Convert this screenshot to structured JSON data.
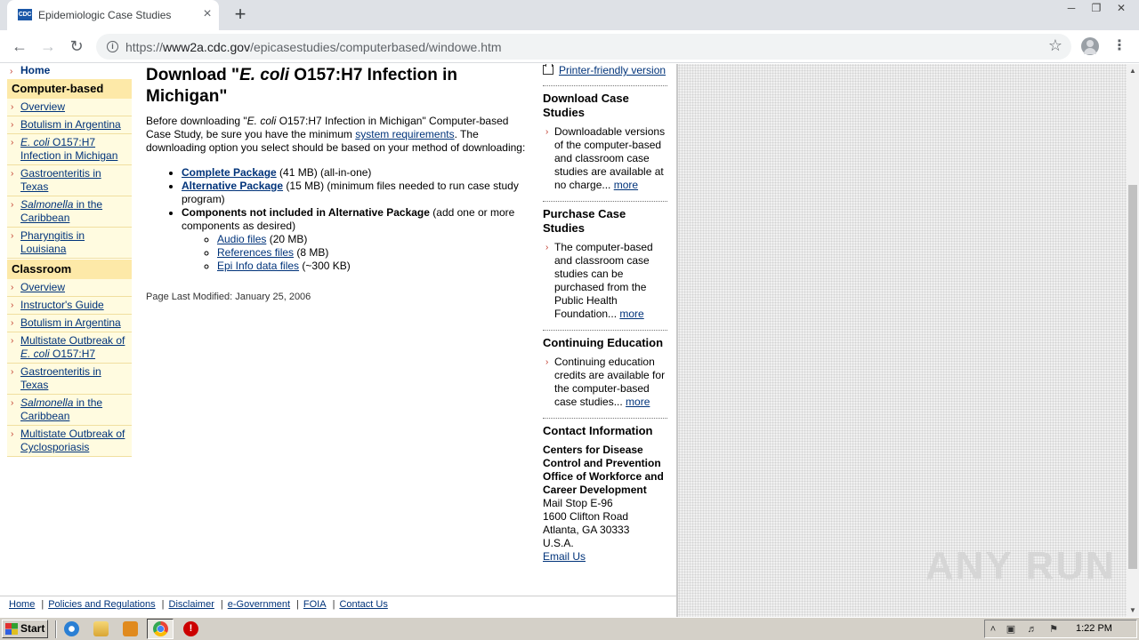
{
  "browser": {
    "tab_title": "Epidemiologic Case Studies",
    "favicon_text": "CDC",
    "url_prefix": "https://",
    "url_host": "www2a.cdc.gov",
    "url_path": "/epicasestudies/computerbased/windowe.htm"
  },
  "leftnav": {
    "home": "Home",
    "computer_based": {
      "heading": "Computer-based",
      "items": [
        {
          "label": "Overview"
        },
        {
          "label": "Botulism in Argentina"
        },
        {
          "italic": "E. coli",
          "rest": " O157:H7 Infection in Michigan"
        },
        {
          "label": "Gastroenteritis in Texas"
        },
        {
          "italic": "Salmonella",
          "rest": " in the Caribbean"
        },
        {
          "label": "Pharyngitis in Louisiana"
        }
      ]
    },
    "classroom": {
      "heading": "Classroom",
      "items": [
        {
          "label": "Overview"
        },
        {
          "label": "Instructor's Guide"
        },
        {
          "label": "Botulism in Argentina"
        },
        {
          "pre": "Multistate Outbreak of ",
          "italic": "E. coli",
          "rest": " O157:H7"
        },
        {
          "label": "Gastroenteritis in Texas"
        },
        {
          "italic": "Salmonella",
          "rest": " in the Caribbean"
        },
        {
          "label": "Multistate Outbreak of Cyclosporiasis"
        }
      ]
    }
  },
  "main": {
    "title_pre": "Download \"",
    "title_italic": "E. coli",
    "title_rest": " O157:H7 Infection in Michigan\"",
    "intro_1": "Before downloading \"",
    "intro_italic": "E. coli",
    "intro_2": " O157:H7 Infection in Michigan\" Computer-based Case Study, be sure you have the minimum ",
    "intro_link": "system requirements",
    "intro_3": ". The downloading option you select should be based on your method of downloading:",
    "complete_label": "Complete Package",
    "complete_desc": " (41 MB) (all-in-one)",
    "alternative_label": "Alternative Package",
    "alternative_desc": " (15 MB) (minimum files needed to run case study program)",
    "components_label": "Components not included in Alternative Package",
    "components_desc": " (add one or more components as desired)",
    "audio_label": "Audio files",
    "audio_desc": " (20 MB)",
    "references_label": "References files",
    "references_desc": " (8 MB)",
    "epiinfo_label": "Epi Info data files",
    "epiinfo_desc": " (~300 KB)",
    "modified": "Page Last Modified: January 25, 2006"
  },
  "rightcol": {
    "printer": "Printer-friendly version",
    "download_head": "Download Case Studies",
    "download_body": "Downloadable versions of the computer-based and classroom case studies are available at no charge... ",
    "purchase_head": "Purchase Case Studies",
    "purchase_body": "The computer-based and classroom case studies can be purchased from the Public Health Foundation... ",
    "ce_head": "Continuing Education",
    "ce_body": "Continuing education credits are available for the computer-based case studies... ",
    "more": "more",
    "contact_head": "Contact Information",
    "org_1": "Centers for Disease Control and Prevention",
    "org_2": "Office of Workforce and Career Development",
    "mail_stop": "Mail Stop E-96",
    "street": "1600 Clifton Road",
    "city": "Atlanta, GA 30333",
    "country": "U.S.A.",
    "email": "Email Us"
  },
  "footer": {
    "links": [
      "Home",
      "Policies and Regulations",
      "Disclaimer",
      "e-Government",
      "FOIA",
      "Contact Us"
    ]
  },
  "watermark": "ANY RUN",
  "taskbar": {
    "start": "Start",
    "clock": "1:22 PM"
  }
}
